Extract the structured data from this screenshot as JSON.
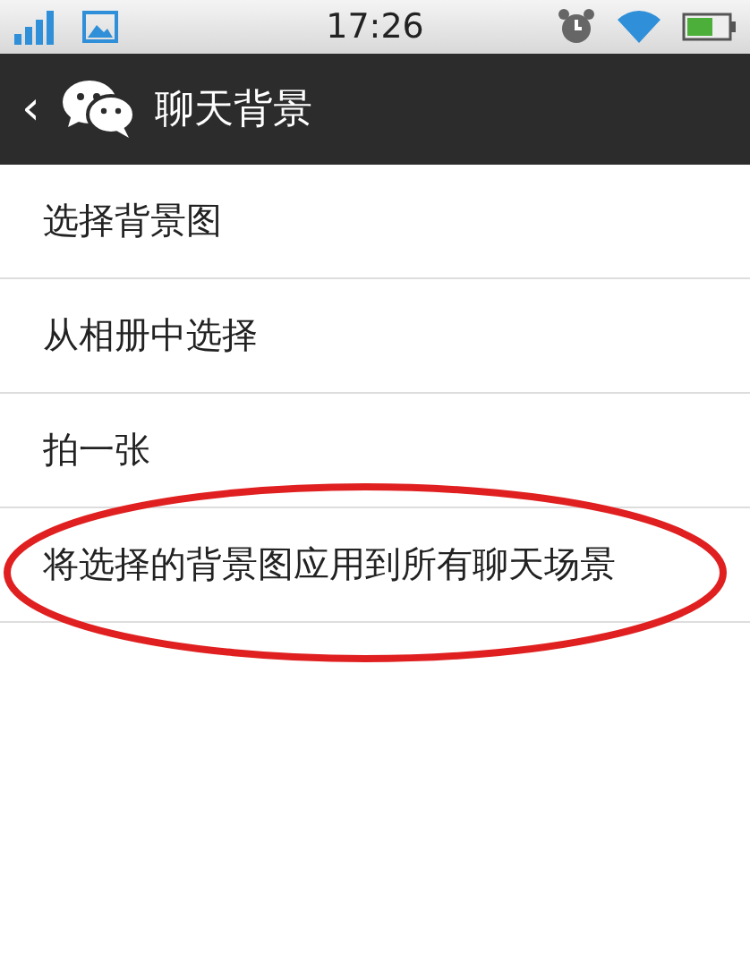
{
  "status_bar": {
    "time": "17:26"
  },
  "header": {
    "back": "‹",
    "title": "聊天背景"
  },
  "items": [
    {
      "label": "选择背景图",
      "circled": false
    },
    {
      "label": "从相册中选择",
      "circled": false
    },
    {
      "label": "拍一张",
      "circled": false
    },
    {
      "label": "将选择的背景图应用到所有聊天场景",
      "circled": true
    }
  ]
}
